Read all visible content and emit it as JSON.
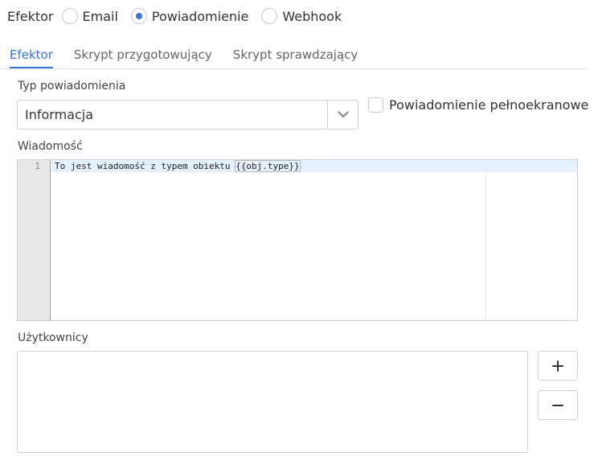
{
  "effector_type": {
    "label": "Efektor",
    "options": [
      {
        "label": "Email",
        "selected": false
      },
      {
        "label": "Powiadomienie",
        "selected": true
      },
      {
        "label": "Webhook",
        "selected": false
      }
    ]
  },
  "tabs": [
    {
      "label": "Efektor",
      "active": true
    },
    {
      "label": "Skrypt przygotowujący",
      "active": false
    },
    {
      "label": "Skrypt sprawdzający",
      "active": false
    }
  ],
  "notification_type": {
    "label": "Typ powiadomienia",
    "value": "Informacja"
  },
  "fullscreen": {
    "label": "Powiadomienie pełnoekranowe",
    "checked": false
  },
  "message": {
    "label": "Wiadomość",
    "line_number": "1",
    "text": "To jest wiadomość z typem obiektu ",
    "template_var": "{{obj.type}}"
  },
  "users": {
    "label": "Użytkownicy",
    "add_label": "+",
    "remove_label": "−"
  },
  "colors": {
    "accent": "#3b73d4",
    "active_line": "#e6f1ff",
    "gutter": "#e8e8e8"
  }
}
